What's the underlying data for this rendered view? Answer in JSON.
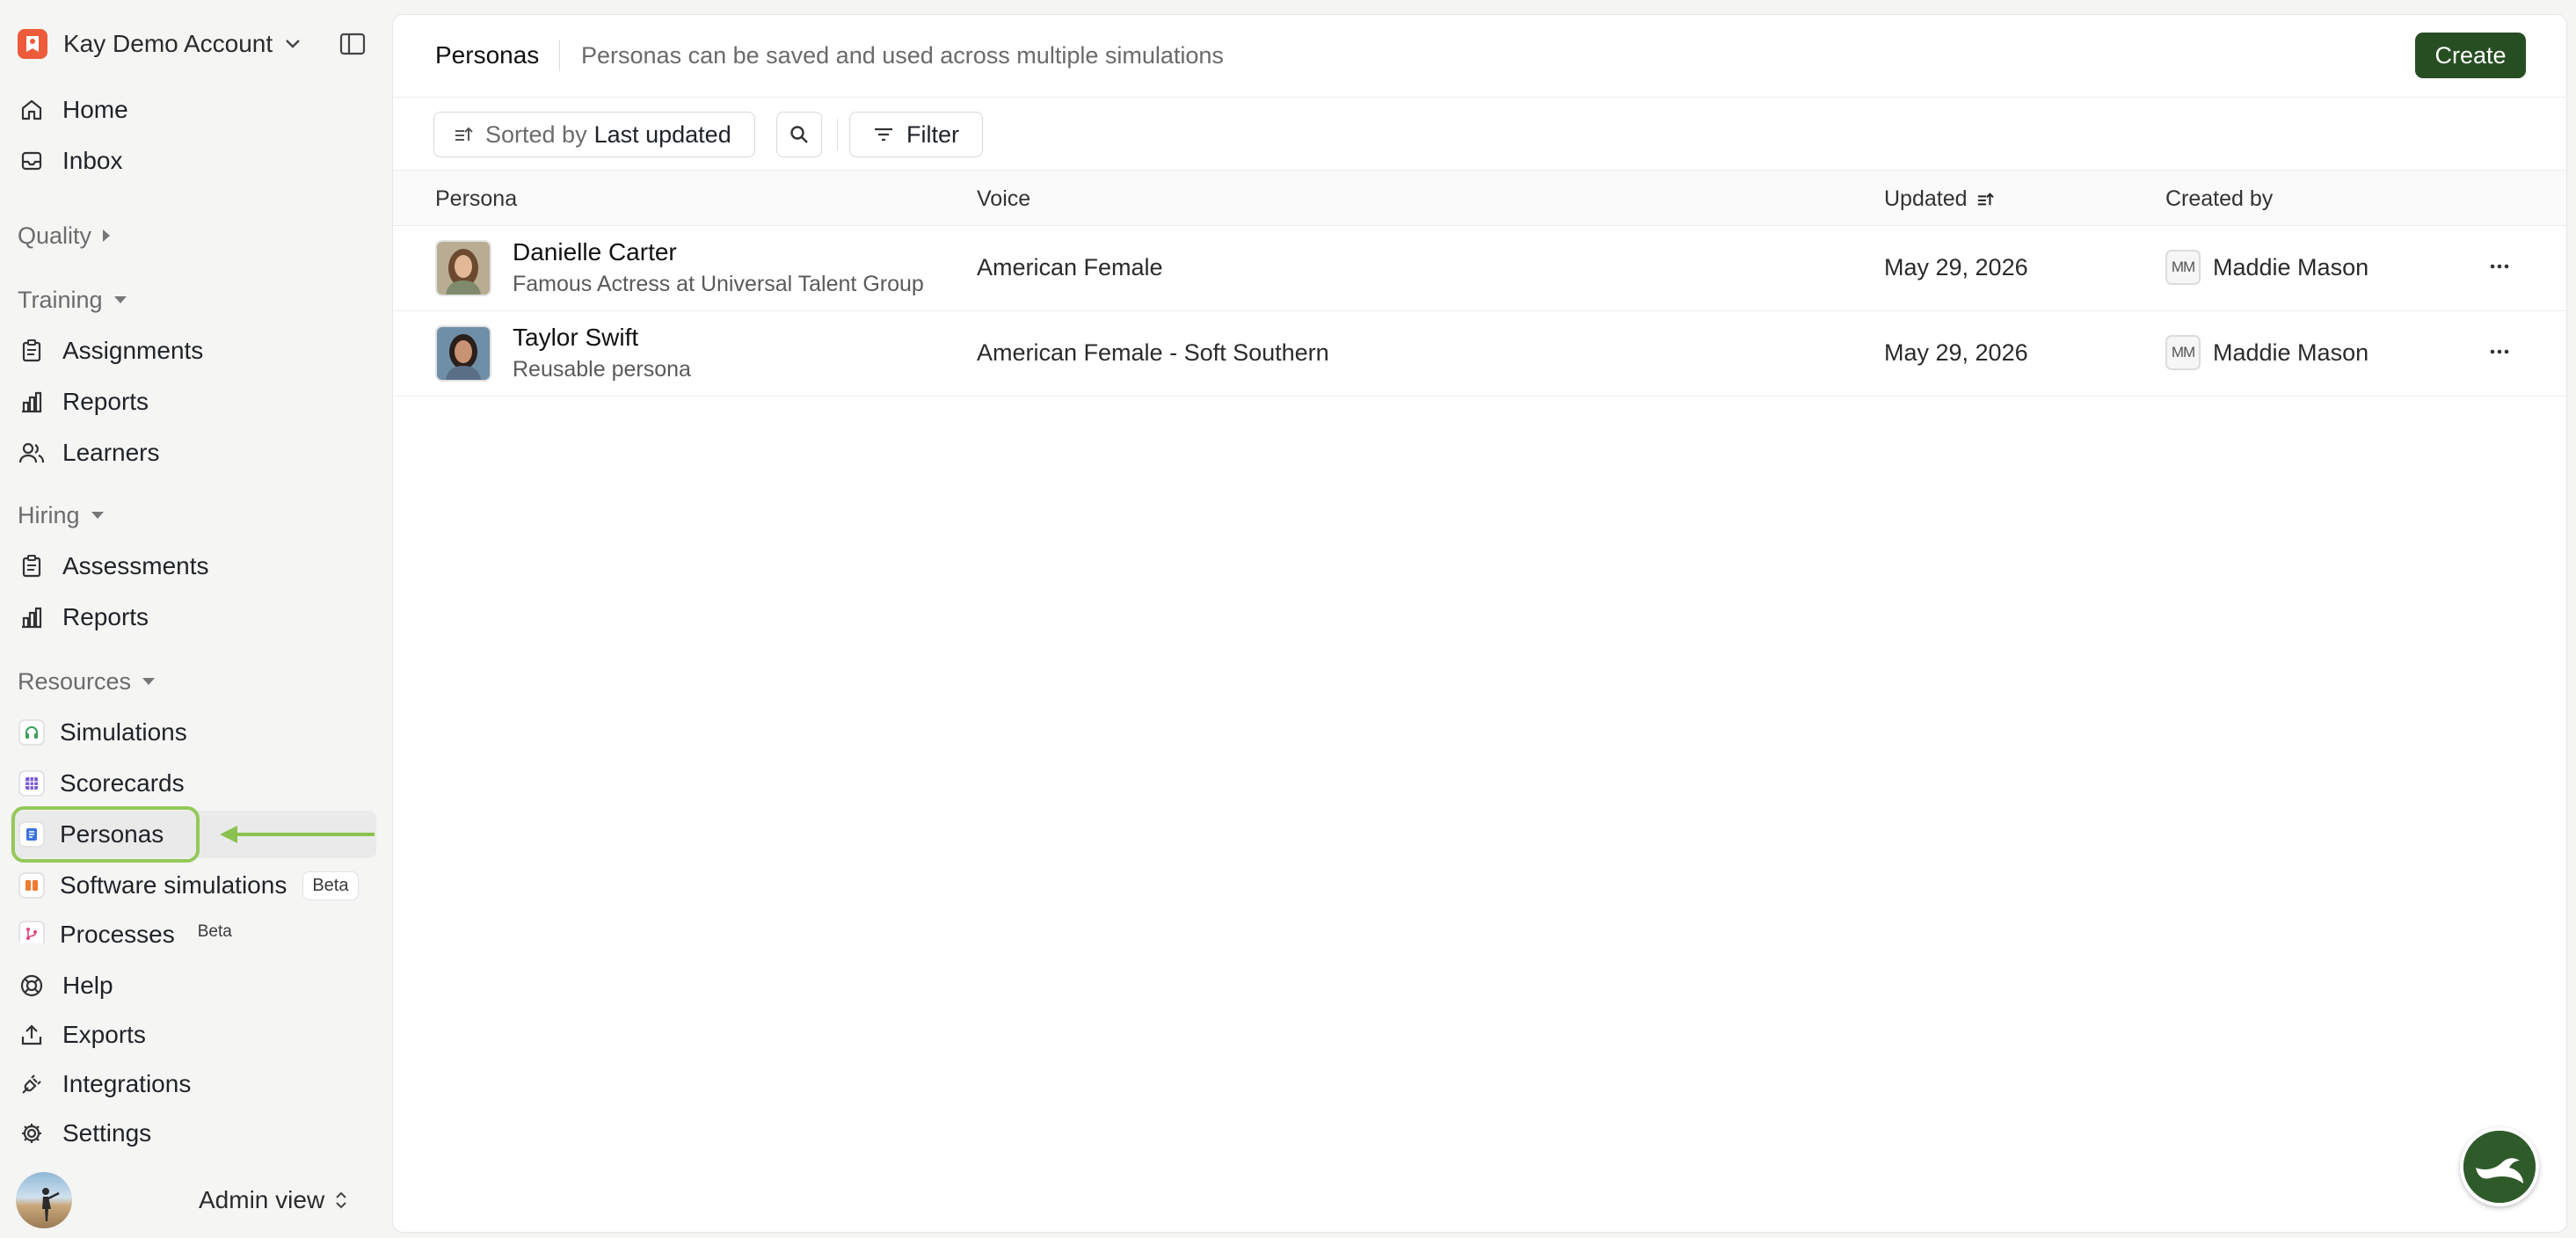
{
  "account": {
    "name": "Kay Demo Account"
  },
  "nav": {
    "primary": [
      {
        "label": "Home",
        "icon": "home-icon"
      },
      {
        "label": "Inbox",
        "icon": "inbox-icon"
      }
    ],
    "quality": {
      "label": "Quality"
    },
    "training": {
      "label": "Training",
      "items": [
        {
          "label": "Assignments",
          "icon": "clipboard-icon"
        },
        {
          "label": "Reports",
          "icon": "bar-chart-icon"
        },
        {
          "label": "Learners",
          "icon": "users-icon"
        }
      ]
    },
    "hiring": {
      "label": "Hiring",
      "items": [
        {
          "label": "Assessments",
          "icon": "clipboard-icon"
        },
        {
          "label": "Reports",
          "icon": "bar-chart-icon"
        }
      ]
    },
    "resources": {
      "label": "Resources",
      "items": [
        {
          "label": "Simulations",
          "icon": "headset-icon",
          "color": "#3aa35a"
        },
        {
          "label": "Scorecards",
          "icon": "grid-icon",
          "color": "#7a5ad6"
        },
        {
          "label": "Personas",
          "icon": "document-icon",
          "color": "#3b73e0",
          "active": true
        },
        {
          "label": "Software simulations",
          "icon": "columns-icon",
          "color": "#ee7a2e",
          "badge": "Beta"
        },
        {
          "label": "Processes",
          "icon": "branch-icon",
          "color": "#e0457a",
          "badge": "Beta"
        }
      ]
    },
    "footer": [
      {
        "label": "Help",
        "icon": "lifebuoy-icon"
      },
      {
        "label": "Exports",
        "icon": "upload-icon"
      },
      {
        "label": "Integrations",
        "icon": "plug-icon"
      },
      {
        "label": "Settings",
        "icon": "gear-icon"
      }
    ],
    "user": {
      "view_label": "Admin view"
    }
  },
  "page": {
    "title": "Personas",
    "subtitle": "Personas can be saved and used across multiple simulations",
    "create_label": "Create"
  },
  "toolbar": {
    "sort_prefix": "Sorted by",
    "sort_value": "Last updated",
    "filter_label": "Filter"
  },
  "table": {
    "columns": [
      "Persona",
      "Voice",
      "Updated",
      "Created by"
    ],
    "rows": [
      {
        "name": "Danielle Carter",
        "subtitle": "Famous Actress at Universal Talent Group",
        "voice": "American Female",
        "updated": "May 29, 2026",
        "creator_initials": "MM",
        "creator": "Maddie Mason"
      },
      {
        "name": "Taylor Swift",
        "subtitle": "Reusable persona",
        "voice": "American Female - Soft Southern",
        "updated": "May 29, 2026",
        "creator_initials": "MM",
        "creator": "Maddie Mason"
      }
    ]
  },
  "colors": {
    "accent": "#274d22",
    "highlight": "#94c95a",
    "brand": "#ee5b3a"
  }
}
